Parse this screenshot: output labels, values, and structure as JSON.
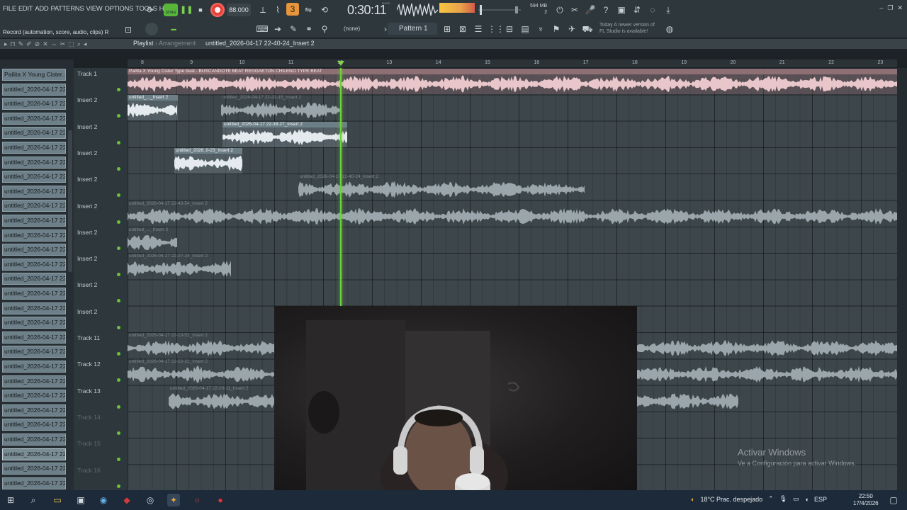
{
  "menu": [
    "FILE",
    "EDIT",
    "ADD",
    "PATTERNS",
    "VIEW",
    "OPTIONS",
    "TOOLS",
    "HELP"
  ],
  "transport": {
    "song_mode": "SONG",
    "tempo": "88.000",
    "time": "0:30:11",
    "time_unit": "M:S:CS"
  },
  "memory": {
    "line1": "594 MB",
    "line2": "2"
  },
  "update_note": {
    "line1": "Today A newer version of",
    "line2": "FL Studio is available!"
  },
  "hint": "Record (automation, score, audio, clips) R",
  "pattern": "Pattern 1",
  "snap": "(none)",
  "playlist": {
    "title": "Playlist",
    "title_sub": "Arrangement",
    "file": "untitled_2026-04-17 22-40-24_Insert 2",
    "ruler": [
      "8",
      "9",
      "10",
      "11",
      "12",
      "13",
      "14",
      "15",
      "16",
      "17",
      "18",
      "19",
      "20",
      "21",
      "22",
      "23"
    ]
  },
  "browser": {
    "items": [
      "Pailita X Young Cister...",
      "untitled_2026-04-17 22-...",
      "untitled_2026-04-17 22-...",
      "untitled_2026-04-17 22-...",
      "untitled_2026-04-17 22-...",
      "untitled_2026-04-17 22-...",
      "untitled_2026-04-17 22-...",
      "untitled_2026-04-17 22-...",
      "untitled_2026-04-17 22-...",
      "untitled_2026-04-17 22-...",
      "untitled_2026-04-17 22-...",
      "untitled_2026-04-17 22-...",
      "untitled_2026-04-17 22-...",
      "untitled_2026-04-17 22-...",
      "untitled_2026-04-17 22-...",
      "untitled_2026-04-17 22-...",
      "untitled_2026-04-17 22-...",
      "untitled_2026-04-17 22-...",
      "untitled_2026-04-17 22-...",
      "untitled_2026-04-17 22-...",
      "untitled_2026-04-17 22-...",
      "untitled_2026-04-17 22-...",
      "untitled_2026-04-17 22-...",
      "untitled_2026-04-17 22-...",
      "untitled_2026-04-17 22-...",
      "untitled_2026-04-17 22-...",
      "untitled_2026-04-17 22-...",
      "untitled_2026-04-17 22-...",
      "untitled_2026-04-17 22-..."
    ]
  },
  "tracks": [
    {
      "name": "Track 1",
      "dim": false
    },
    {
      "name": "Insert 2",
      "dim": false
    },
    {
      "name": "Insert 2",
      "dim": false
    },
    {
      "name": "Insert 2",
      "dim": false
    },
    {
      "name": "Insert 2",
      "dim": false
    },
    {
      "name": "Insert 2",
      "dim": false
    },
    {
      "name": "Insert 2",
      "dim": false
    },
    {
      "name": "Insert 2",
      "dim": false
    },
    {
      "name": "Insert 2",
      "dim": false
    },
    {
      "name": "Insert 2",
      "dim": false
    },
    {
      "name": "Track 11",
      "dim": false
    },
    {
      "name": "Track 12",
      "dim": false
    },
    {
      "name": "Track 13",
      "dim": false
    },
    {
      "name": "Track 14",
      "dim": true
    },
    {
      "name": "Track 15",
      "dim": true
    },
    {
      "name": "Track 16",
      "dim": true
    }
  ],
  "clips": [
    {
      "track": 0,
      "start": 0,
      "len": 1086,
      "label": "Pailita X Young Cister Type beat - BUSCANDOTE BEAT REGGAETON CHILENO TYPE BEAT",
      "kind": "t1"
    },
    {
      "track": 1,
      "start": 0,
      "len": 71,
      "label": "untitled_..._Insert 2",
      "kind": "active"
    },
    {
      "track": 1,
      "start": 132,
      "len": 170,
      "label": "untitled_2026-04-17 22-32-15_Insert 2",
      "kind": "muted"
    },
    {
      "track": 2,
      "start": 134,
      "len": 176,
      "label": "untitled_2026-04-17 22-39-27_Insert 2",
      "kind": "active"
    },
    {
      "track": 3,
      "start": 66,
      "len": 96,
      "label": "untitled_2026..0-23_Insert 2",
      "kind": "active"
    },
    {
      "track": 4,
      "start": 241,
      "len": 404,
      "label": "untitled_2026-04-17 22-40-24_Insert 2",
      "kind": "muted"
    },
    {
      "track": 5,
      "start": 0,
      "len": 1086,
      "label": "untitled_2026-04-17 22-43-54_Insert 2",
      "kind": "muted"
    },
    {
      "track": 6,
      "start": 0,
      "len": 70,
      "label": "untitled_..._Insert 2",
      "kind": "muted"
    },
    {
      "track": 7,
      "start": 0,
      "len": 146,
      "label": "untitled_2026-04-17 22-27-24_Insert 2",
      "kind": "muted"
    },
    {
      "track": 10,
      "start": 0,
      "len": 1086,
      "label": "untitled_2026-04-17 22-13-52_Insert 2",
      "kind": "muted"
    },
    {
      "track": 11,
      "start": 0,
      "len": 1086,
      "label": "untitled_2026-04-17 22-22-22_Insert 2",
      "kind": "muted"
    },
    {
      "track": 12,
      "start": 58,
      "len": 804,
      "label": "untitled_2026-04-17 22-20-11_Insert 2",
      "kind": "muted"
    }
  ],
  "watermark": {
    "line1": "Activar Windows",
    "line2": "Ve a Configuración para activar Windows."
  },
  "taskbar": {
    "weather": "18°C  Prac. despejado",
    "lang": "ESP",
    "time": "22:50",
    "date": "17/4/2026"
  },
  "colors": {
    "record": "#e8433b",
    "playhead": "#6fd23a",
    "song_mode": "#59b43a"
  }
}
